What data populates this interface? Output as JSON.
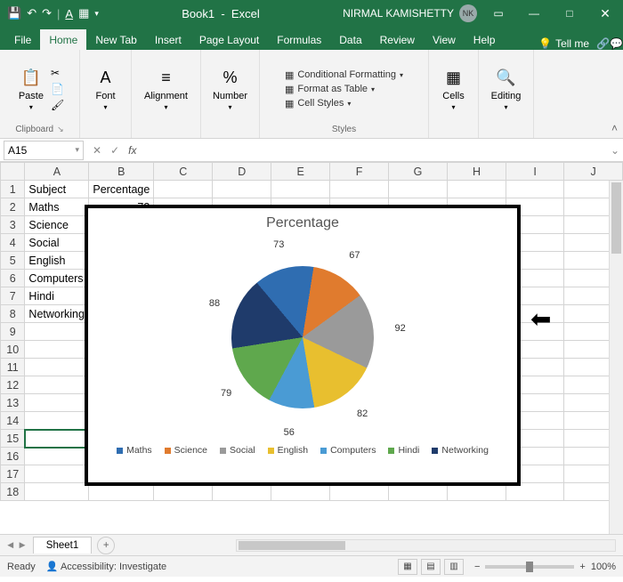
{
  "title": {
    "document": "Book1",
    "app": "Excel",
    "user": "NIRMAL KAMISHETTY",
    "initials": "NK"
  },
  "tabs": {
    "items": [
      "File",
      "Home",
      "New Tab",
      "Insert",
      "Page Layout",
      "Formulas",
      "Data",
      "Review",
      "View",
      "Help"
    ],
    "active": "Home",
    "tellme": "Tell me"
  },
  "ribbon": {
    "clipboard": {
      "paste": "Paste",
      "label": "Clipboard"
    },
    "font": {
      "label": "Font"
    },
    "alignment": {
      "label": "Alignment"
    },
    "number": {
      "label": "Number"
    },
    "styles": {
      "conditional": "Conditional Formatting",
      "formatTable": "Format as Table",
      "cellStyles": "Cell Styles",
      "label": "Styles"
    },
    "cells": {
      "label": "Cells"
    },
    "editing": {
      "label": "Editing"
    }
  },
  "namebox": "A15",
  "fx": "fx",
  "columns": [
    "A",
    "B",
    "C",
    "D",
    "E",
    "F",
    "G",
    "H",
    "I",
    "J"
  ],
  "rows": [
    {
      "n": 1,
      "A": "Subject",
      "B": "Percentage"
    },
    {
      "n": 2,
      "A": "Maths",
      "B": "73"
    },
    {
      "n": 3,
      "A": "Science",
      "B": ""
    },
    {
      "n": 4,
      "A": "Social",
      "B": ""
    },
    {
      "n": 5,
      "A": "English",
      "B": ""
    },
    {
      "n": 6,
      "A": "Computers",
      "B": ""
    },
    {
      "n": 7,
      "A": "Hindi",
      "B": ""
    },
    {
      "n": 8,
      "A": "Networking",
      "B": ""
    },
    {
      "n": 9
    },
    {
      "n": 10
    },
    {
      "n": 11
    },
    {
      "n": 12
    },
    {
      "n": 13
    },
    {
      "n": 14
    },
    {
      "n": 15
    },
    {
      "n": 16
    },
    {
      "n": 17
    },
    {
      "n": 18
    }
  ],
  "selectedRow": 15,
  "chart_data": {
    "type": "pie",
    "title": "Percentage",
    "categories": [
      "Maths",
      "Science",
      "Social",
      "English",
      "Computers",
      "Hindi",
      "Networking"
    ],
    "values": [
      73,
      67,
      92,
      82,
      56,
      79,
      88
    ],
    "colors": [
      "#2f6db1",
      "#e07b2e",
      "#9a9a9a",
      "#e8bf2f",
      "#4a9bd4",
      "#5fa84d",
      "#1f3b6b"
    ]
  },
  "sheet": {
    "name": "Sheet1"
  },
  "status": {
    "ready": "Ready",
    "accessibility": "Accessibility: Investigate",
    "zoom": "100%"
  }
}
